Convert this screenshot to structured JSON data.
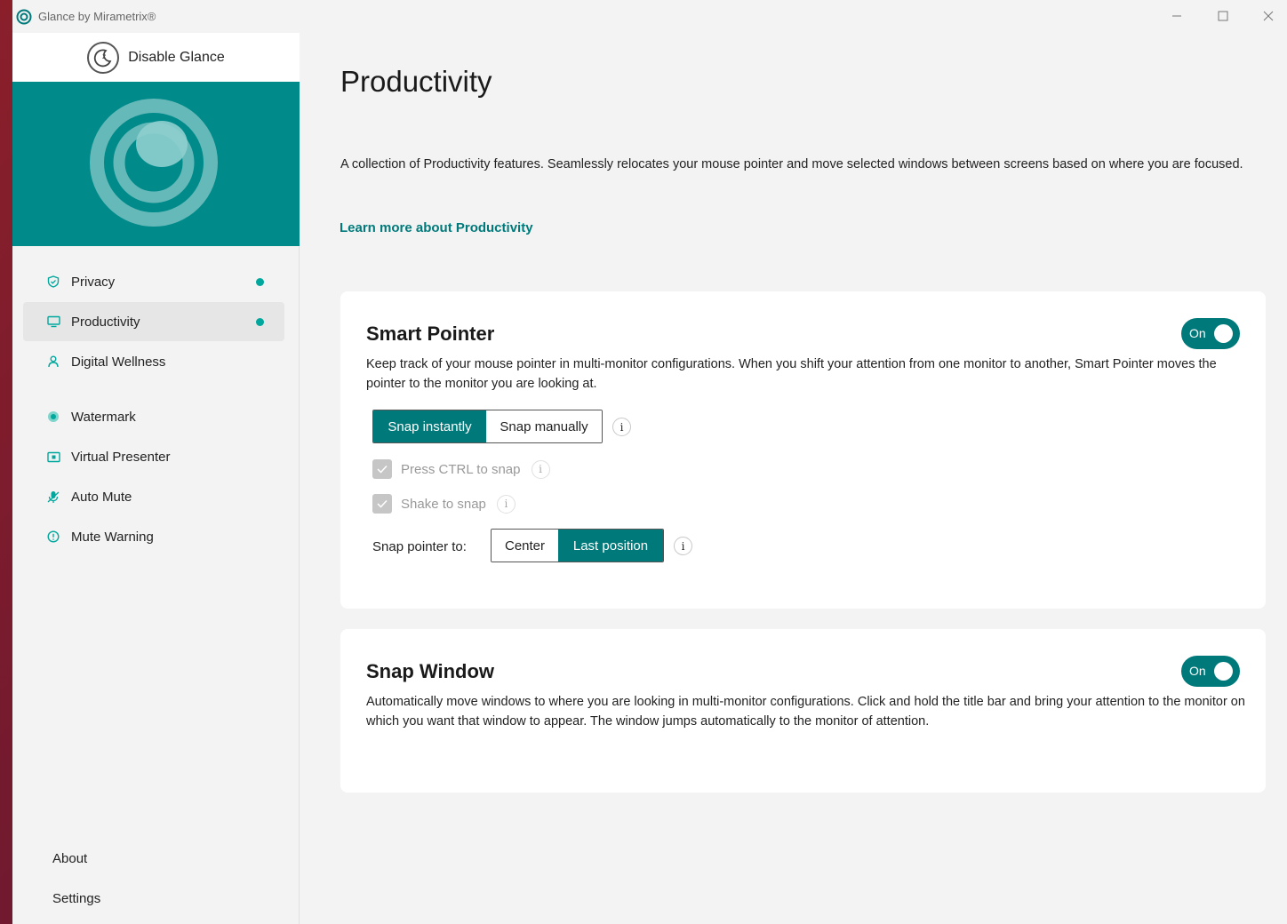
{
  "window": {
    "title": "Glance by Mirametrix®"
  },
  "sidebar": {
    "disable_label": "Disable Glance",
    "items": [
      {
        "label": "Privacy",
        "icon": "shield-icon",
        "dot": true
      },
      {
        "label": "Productivity",
        "icon": "monitor-icon",
        "dot": true,
        "active": true
      },
      {
        "label": "Digital Wellness",
        "icon": "person-icon",
        "dot": false
      },
      {
        "label": "Watermark",
        "icon": "flower-icon",
        "dot": false
      },
      {
        "label": "Virtual Presenter",
        "icon": "presenter-icon",
        "dot": false
      },
      {
        "label": "Auto Mute",
        "icon": "mic-mute-icon",
        "dot": false
      },
      {
        "label": "Mute Warning",
        "icon": "warning-circle-icon",
        "dot": false
      }
    ],
    "bottom": {
      "about": "About",
      "settings": "Settings"
    }
  },
  "main": {
    "title": "Productivity",
    "description": "A collection of Productivity features. Seamlessly relocates your mouse pointer and move selected windows between screens based on where you are focused.",
    "learn_more": "Learn more about Productivity"
  },
  "smart_pointer": {
    "title": "Smart Pointer",
    "toggle": "On",
    "description": "Keep track of your mouse pointer in multi-monitor configurations. When you shift your attention from one monitor to another, Smart Pointer moves the pointer to the monitor you are looking at.",
    "mode_options": [
      "Snap instantly",
      "Snap manually"
    ],
    "mode_selected": "Snap instantly",
    "press_ctrl": "Press CTRL to snap",
    "shake": "Shake to snap",
    "snap_to_label": "Snap pointer to:",
    "snap_to_options": [
      "Center",
      "Last position"
    ],
    "snap_to_selected": "Last position",
    "info_glyph": "i"
  },
  "snap_window": {
    "title": "Snap Window",
    "toggle": "On",
    "description": "Automatically move windows to where you are looking in multi-monitor configurations. Click and hold the title bar and bring your attention to the monitor on which you want that window to appear. The window jumps automatically to the monitor of attention."
  },
  "colors": {
    "accent": "#00797a",
    "hero": "#008a8a",
    "dot": "#00a79d"
  }
}
